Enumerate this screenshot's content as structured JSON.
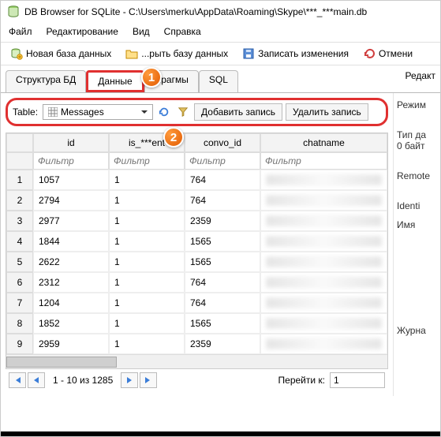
{
  "window": {
    "title": "DB Browser for SQLite - C:\\Users\\merku\\AppData\\Roaming\\Skype\\***_***main.db"
  },
  "menu": {
    "file": "Файл",
    "edit": "Редактирование",
    "view": "Вид",
    "help": "Справка"
  },
  "toolbar": {
    "new_db": "Новая база данных",
    "open_db": "...рыть базу данных",
    "write_changes": "Записать изменения",
    "revert": "Отмени"
  },
  "tabs": {
    "structure": "Структура БД",
    "data": "Данные",
    "pragmas": "Прагмы",
    "sql": "SQL",
    "right_edit": "Редакт"
  },
  "tablebar": {
    "label": "Table:",
    "selected": "Messages",
    "add_row": "Добавить запись",
    "delete_row": "Удалить запись"
  },
  "callouts": {
    "c1": "1",
    "c2": "2"
  },
  "grid": {
    "headers": [
      "id",
      "is_***ent",
      "convo_id",
      "chatname"
    ],
    "filter_placeholder": "Фильтр",
    "rows": [
      {
        "n": "1",
        "id": "1057",
        "is": "1",
        "convo": "764"
      },
      {
        "n": "2",
        "id": "2794",
        "is": "1",
        "convo": "764"
      },
      {
        "n": "3",
        "id": "2977",
        "is": "1",
        "convo": "2359"
      },
      {
        "n": "4",
        "id": "1844",
        "is": "1",
        "convo": "1565"
      },
      {
        "n": "5",
        "id": "2622",
        "is": "1",
        "convo": "1565"
      },
      {
        "n": "6",
        "id": "2312",
        "is": "1",
        "convo": "764"
      },
      {
        "n": "7",
        "id": "1204",
        "is": "1",
        "convo": "764"
      },
      {
        "n": "8",
        "id": "1852",
        "is": "1",
        "convo": "1565"
      },
      {
        "n": "9",
        "id": "2959",
        "is": "1",
        "convo": "2359"
      }
    ]
  },
  "pager": {
    "status": "1 - 10 из 1285",
    "goto_label": "Перейти к:",
    "goto_value": "1"
  },
  "side": {
    "mode": "Режим",
    "datatype": "Тип да",
    "bytes": "0 байт",
    "remote": "Remote",
    "identity": "Identi",
    "name": "Имя",
    "journal": "Журна"
  }
}
